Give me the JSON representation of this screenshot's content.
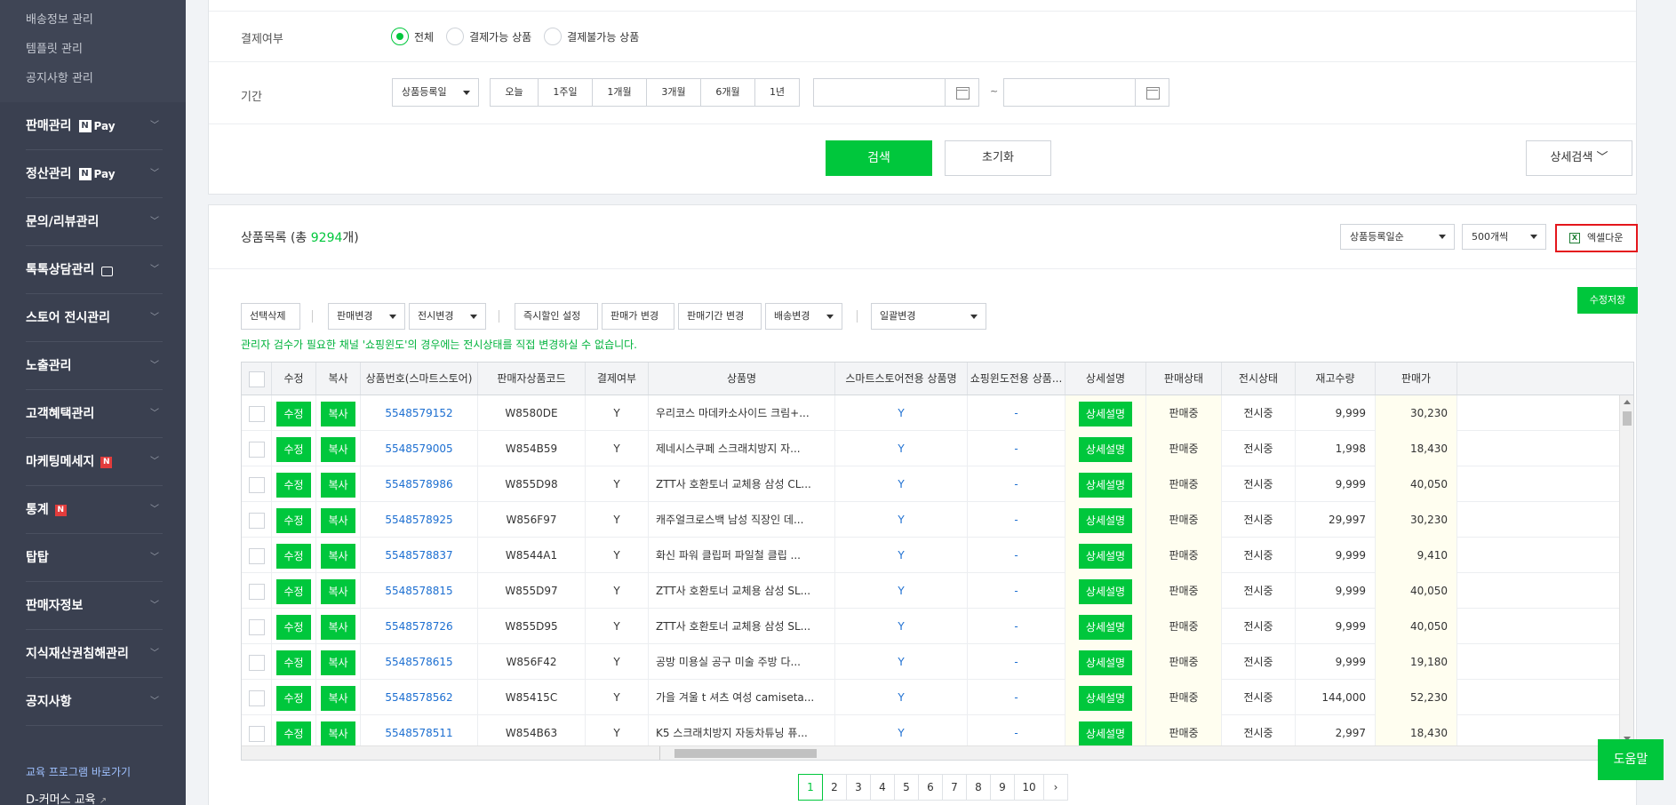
{
  "sidebar": {
    "sub_items": [
      "배송정보 관리",
      "템플릿 관리",
      "공지사항 관리"
    ],
    "menu": [
      {
        "label": "판매관리",
        "badge": "npay"
      },
      {
        "label": "정산관리",
        "badge": "npay"
      },
      {
        "label": "문의/리뷰관리",
        "badge": ""
      },
      {
        "label": "톡톡상담관리",
        "badge": "talk"
      },
      {
        "label": "스토어 전시관리",
        "badge": ""
      },
      {
        "label": "노출관리",
        "badge": ""
      },
      {
        "label": "고객혜택관리",
        "badge": ""
      },
      {
        "label": "마케팅메세지",
        "badge": "new"
      },
      {
        "label": "통계",
        "badge": "new"
      },
      {
        "label": "탑탑",
        "badge": ""
      },
      {
        "label": "판매자정보",
        "badge": ""
      },
      {
        "label": "지식재산권침해관리",
        "badge": ""
      },
      {
        "label": "공지사항",
        "badge": ""
      }
    ],
    "npay_n": "N",
    "npay_text": "Pay",
    "new_text": "N",
    "chevron": "﹀",
    "bottom_link1": "교육 프로그램 바로가기",
    "bottom_link2": "D-커머스 교육"
  },
  "filter": {
    "pay_label": "결제여부",
    "pay_options": [
      "전체",
      "결제가능 상품",
      "결제불가능 상품"
    ],
    "pay_selected": 0,
    "period_label": "기간",
    "period_select": "상품등록일",
    "period_buttons": [
      "오늘",
      "1주일",
      "1개월",
      "3개월",
      "6개월",
      "1년"
    ],
    "tilde": "~",
    "search_btn": "검색",
    "reset_btn": "초기화",
    "detail_btn": "상세검색 ﹀"
  },
  "list": {
    "title_prefix": "상품목록 (총 ",
    "count": "9294",
    "title_suffix": "개)",
    "sort_select": "상품등록일순",
    "size_select": "500개씩",
    "excel_btn": "엑셀다운",
    "excel_icon": "X",
    "toolbar": {
      "delete": "선택삭제",
      "sale_change": "판매변경",
      "display_change": "전시변경",
      "discount": "즉시할인 설정",
      "price_change": "판매가 변경",
      "period_change": "판매기간 변경",
      "delivery_change": "배송변경",
      "bulk_change": "일괄변경",
      "save_edit": "수정저장"
    },
    "notice": "관리자 검수가 필요한 채널 '쇼핑윈도'의 경우에는 전시상태를 직접 변경하실 수 없습니다.",
    "columns": [
      "수정",
      "복사",
      "상품번호(스마트스토어)",
      "판매자상품코드",
      "결제여부",
      "상품명",
      "스마트스토어전용 상품명",
      "쇼핑윈도전용 상품...",
      "상세설명",
      "판매상태",
      "전시상태",
      "재고수량",
      "판매가"
    ],
    "edit_btn": "수정",
    "copy_btn": "복사",
    "detail_btn": "상세설명",
    "rows": [
      {
        "id": "5548579152",
        "code": "W8580DE",
        "pay": "Y",
        "name": "우리코스 마데카소사이드 크림+...",
        "ss": "Y",
        "sw": "-",
        "sale": "판매중",
        "disp": "전시중",
        "stock": "9,999",
        "price": "30,230"
      },
      {
        "id": "5548579005",
        "code": "W854B59",
        "pay": "Y",
        "name": "제네시스쿠페 스크래치방지 자...",
        "ss": "Y",
        "sw": "-",
        "sale": "판매중",
        "disp": "전시중",
        "stock": "1,998",
        "price": "18,430"
      },
      {
        "id": "5548578986",
        "code": "W855D98",
        "pay": "Y",
        "name": "ZTT사 호환토너 교체용 삼성 CL...",
        "ss": "Y",
        "sw": "-",
        "sale": "판매중",
        "disp": "전시중",
        "stock": "9,999",
        "price": "40,050"
      },
      {
        "id": "5548578925",
        "code": "W856F97",
        "pay": "Y",
        "name": "캐주얼크로스백 남성 직장인 데...",
        "ss": "Y",
        "sw": "-",
        "sale": "판매중",
        "disp": "전시중",
        "stock": "29,997",
        "price": "30,230"
      },
      {
        "id": "5548578837",
        "code": "W8544A1",
        "pay": "Y",
        "name": "화신 파워 클립퍼 파일철 클립 ...",
        "ss": "Y",
        "sw": "-",
        "sale": "판매중",
        "disp": "전시중",
        "stock": "9,999",
        "price": "9,410"
      },
      {
        "id": "5548578815",
        "code": "W855D97",
        "pay": "Y",
        "name": "ZTT사 호환토너 교체용 삼성 SL...",
        "ss": "Y",
        "sw": "-",
        "sale": "판매중",
        "disp": "전시중",
        "stock": "9,999",
        "price": "40,050"
      },
      {
        "id": "5548578726",
        "code": "W855D95",
        "pay": "Y",
        "name": "ZTT사 호환토너 교체용 삼성 SL...",
        "ss": "Y",
        "sw": "-",
        "sale": "판매중",
        "disp": "전시중",
        "stock": "9,999",
        "price": "40,050"
      },
      {
        "id": "5548578615",
        "code": "W856F42",
        "pay": "Y",
        "name": "공방 미용실 공구 미술 주방 다...",
        "ss": "Y",
        "sw": "-",
        "sale": "판매중",
        "disp": "전시중",
        "stock": "9,999",
        "price": "19,180"
      },
      {
        "id": "5548578562",
        "code": "W85415C",
        "pay": "Y",
        "name": "가을 겨울 t 셔츠 여성 camiseta...",
        "ss": "Y",
        "sw": "-",
        "sale": "판매중",
        "disp": "전시중",
        "stock": "144,000",
        "price": "52,230"
      },
      {
        "id": "5548578511",
        "code": "W854B63",
        "pay": "Y",
        "name": "K5 스크래치방지 자동차튜닝 퓨...",
        "ss": "Y",
        "sw": "-",
        "sale": "판매중",
        "disp": "전시중",
        "stock": "2,997",
        "price": "18,430"
      }
    ]
  },
  "pagination": {
    "pages": [
      "1",
      "2",
      "3",
      "4",
      "5",
      "6",
      "7",
      "8",
      "9",
      "10"
    ],
    "current": "1",
    "next": "›"
  },
  "help_btn": "도움말"
}
